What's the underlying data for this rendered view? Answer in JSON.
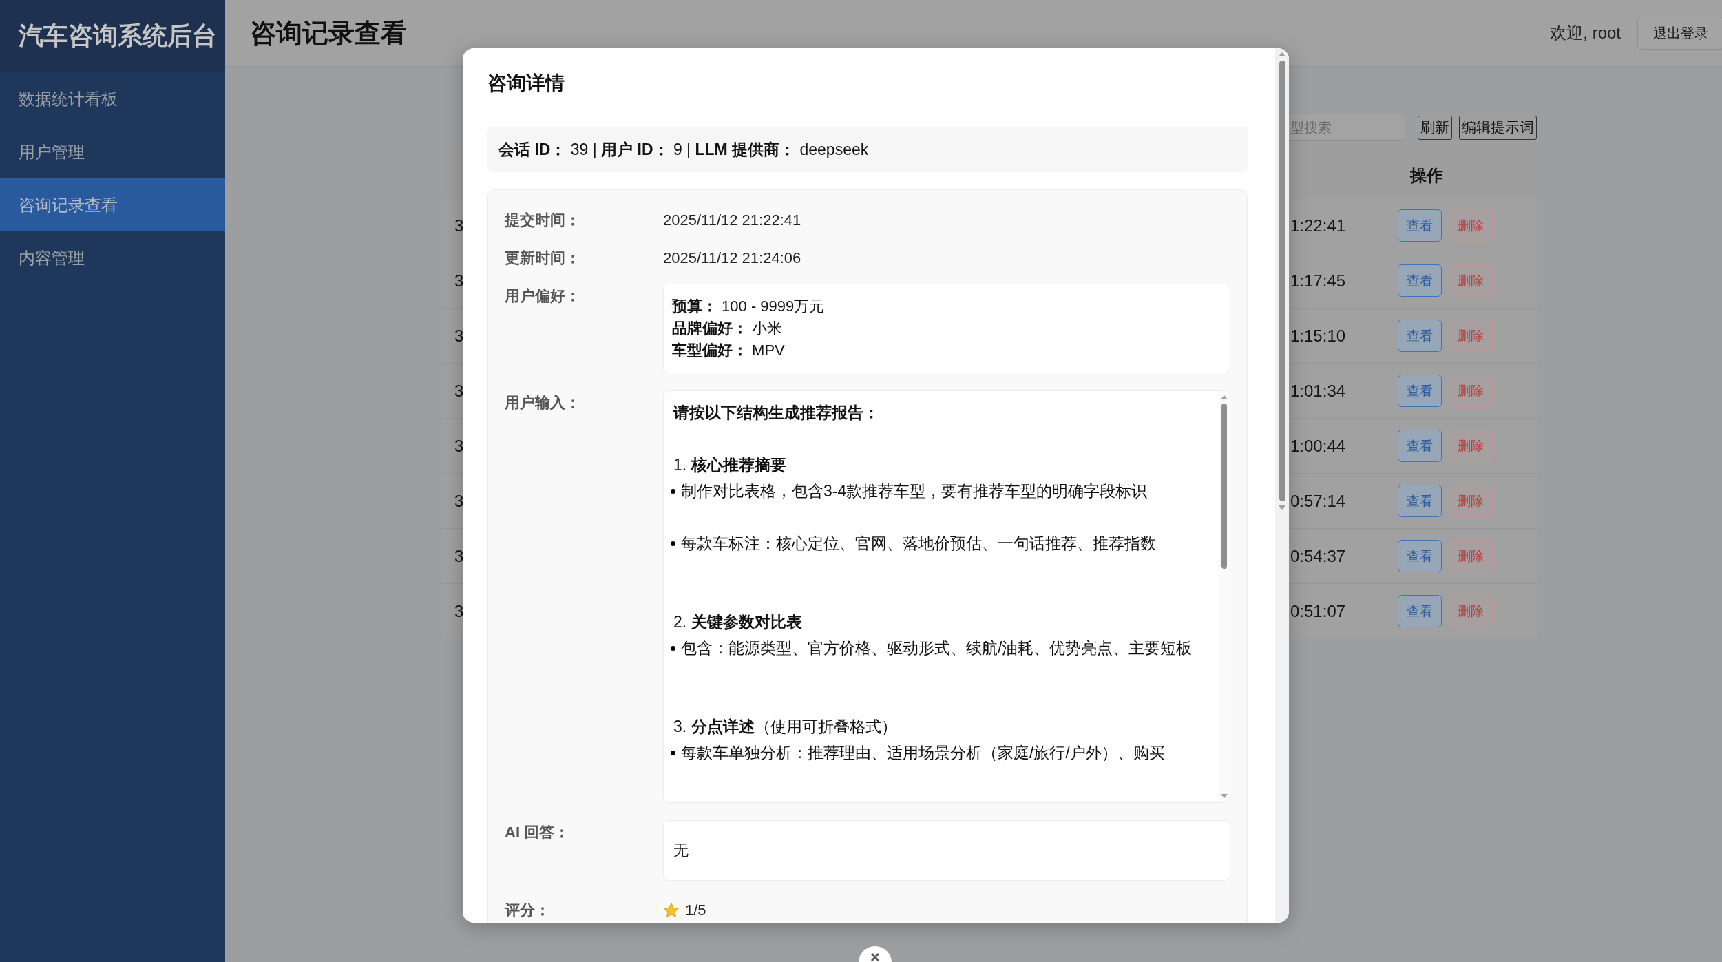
{
  "sidebar": {
    "title": "汽车咨询系统后台",
    "items": [
      {
        "label": "数据统计看板",
        "selected": false
      },
      {
        "label": "用户管理",
        "selected": false
      },
      {
        "label": "咨询记录查看",
        "selected": true
      },
      {
        "label": "内容管理",
        "selected": false
      }
    ]
  },
  "header": {
    "title": "咨询记录查看",
    "welcome": "欢迎, root",
    "logout": "退出登录"
  },
  "page": {
    "search": {
      "placeholder": "型搜索"
    },
    "buttons": [
      "刷新",
      "编辑提示词"
    ]
  },
  "table": {
    "columns": [
      "操作"
    ],
    "rows": [
      {
        "cells": [
          "3",
          "1:22:41"
        ],
        "actions": [
          "查看",
          "删除"
        ]
      },
      {
        "cells": [
          "3",
          "1:17:45"
        ],
        "actions": [
          "查看",
          "删除"
        ]
      },
      {
        "cells": [
          "3",
          "1:15:10"
        ],
        "actions": [
          "查看",
          "删除"
        ]
      },
      {
        "cells": [
          "3",
          "1:01:34"
        ],
        "actions": [
          "查看",
          "删除"
        ]
      },
      {
        "cells": [
          "3",
          "1:00:44"
        ],
        "actions": [
          "查看",
          "删除"
        ]
      },
      {
        "cells": [
          "3",
          "0:57:14"
        ],
        "actions": [
          "查看",
          "删除"
        ]
      },
      {
        "cells": [
          "3",
          "0:54:37"
        ],
        "actions": [
          "查看",
          "删除"
        ]
      },
      {
        "cells": [
          "3",
          "0:51:07"
        ],
        "actions": [
          "查看",
          "删除"
        ]
      }
    ]
  },
  "dialog": {
    "title": "咨询详情",
    "info": "**会话 ID：** 39 | **用户 ID：** 9 | **LLM 提供商：** deepseek",
    "fields": [
      {
        "kind": "text",
        "label": "提交时间：",
        "value": "2025/11/12 21:22:41"
      },
      {
        "kind": "text",
        "label": "更新时间：",
        "value": "2025/11/12 21:24:06"
      },
      {
        "kind": "lines",
        "label": "用户偏好：",
        "lines": [
          "**预算：** 100 - 9999万元",
          "**品牌偏好：** 小米",
          "**车型偏好：** MPV"
        ]
      },
      {
        "kind": "document",
        "label": "用户输入：",
        "blocks": [
          {
            "kind": "heading",
            "text": "请按以下结构生成推荐报告："
          },
          {
            "kind": "section",
            "text": "1. **核心推荐摘要**",
            "bullets": [
              "制作对比表格，包含3-4款推荐车型，要有推荐车型的明确字段标识",
              "每款车标注：核心定位、官网、落地价预估、一句话推荐、推荐指数"
            ]
          },
          {
            "kind": "section",
            "text": "2. **关键参数对比表**",
            "bullets": [
              "包含：能源类型、官方价格、驱动形式、续航/油耗、优势亮点、主要短板"
            ]
          },
          {
            "kind": "section",
            "text": "3. **分点详述**（使用可折叠格式）",
            "bullets": [
              "每款车单独分析：推荐理由、适用场景分析（家庭/旅行/户外）、购买"
            ]
          }
        ]
      },
      {
        "kind": "box",
        "label": "AI 回答：",
        "value": "无"
      },
      {
        "kind": "rating",
        "label": "评分：",
        "value": "1/5"
      }
    ]
  }
}
